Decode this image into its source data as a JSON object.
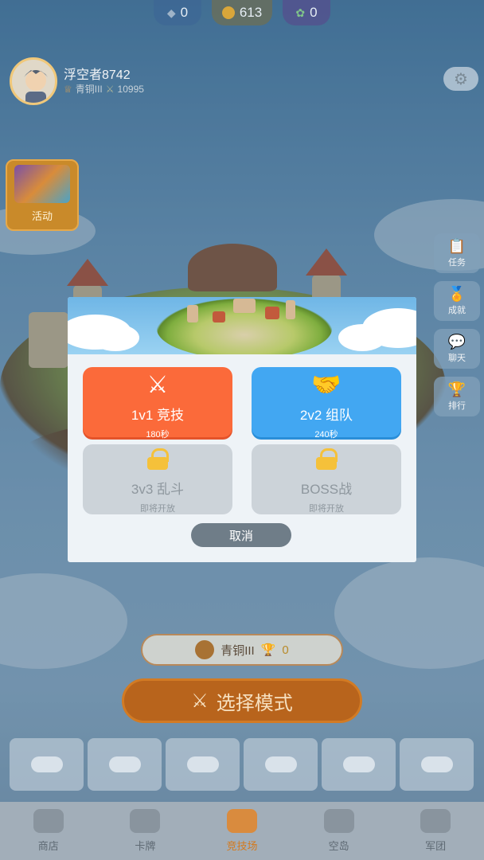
{
  "currencies": [
    {
      "icon": "diamond-icon",
      "value": "0"
    },
    {
      "icon": "coin-icon",
      "value": "613"
    },
    {
      "icon": "energy-icon",
      "value": "0"
    }
  ],
  "player": {
    "name": "浮空者8742",
    "rank": "青铜III",
    "score": "10995"
  },
  "activity": {
    "label": "活动"
  },
  "side_buttons": [
    {
      "icon": "clipboard-icon",
      "label": "任务"
    },
    {
      "icon": "medal-icon",
      "label": "成就"
    },
    {
      "icon": "chat-icon",
      "label": "聊天"
    },
    {
      "icon": "trophy-icon",
      "label": "排行"
    }
  ],
  "rank_pill": {
    "rank": "青铜III",
    "trophies": "0"
  },
  "select_mode": {
    "label": "选择模式"
  },
  "bottom_nav": [
    {
      "label": "商店",
      "active": false
    },
    {
      "label": "卡牌",
      "active": false
    },
    {
      "label": "竞技场",
      "active": true
    },
    {
      "label": "空岛",
      "active": false
    },
    {
      "label": "军团",
      "active": false
    }
  ],
  "modal": {
    "modes": [
      {
        "title": "1v1 竞技",
        "sub": "180秒",
        "state": "available",
        "color": "#fb6a3a"
      },
      {
        "title": "2v2 组队",
        "sub": "240秒",
        "state": "available",
        "color": "#42a7f2"
      },
      {
        "title": "3v3 乱斗",
        "sub": "即将开放",
        "state": "locked"
      },
      {
        "title": "BOSS战",
        "sub": "即将开放",
        "state": "locked"
      }
    ],
    "cancel_label": "取消"
  }
}
